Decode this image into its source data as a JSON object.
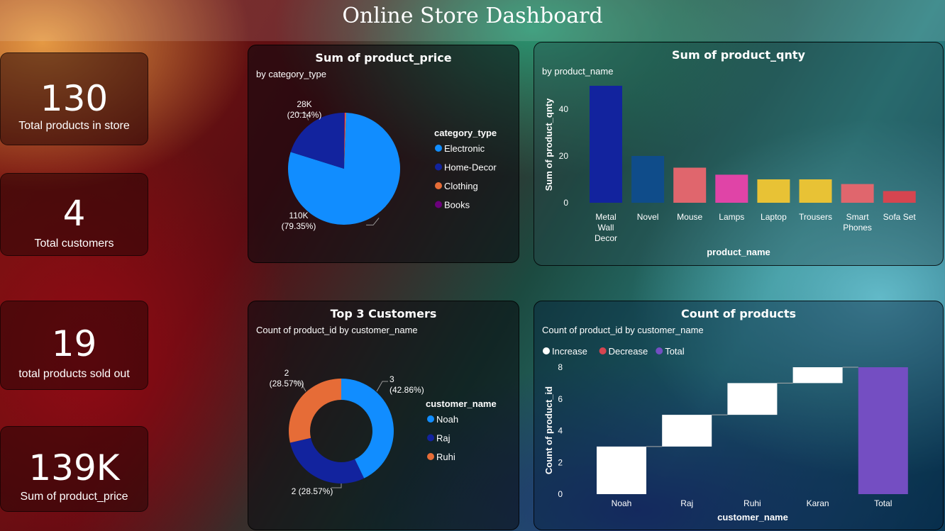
{
  "page_title": "Online Store Dashboard",
  "kpis": [
    {
      "value": "130",
      "label": "Total products in store"
    },
    {
      "value": "4",
      "label": "Total customers"
    },
    {
      "value": "19",
      "label": "total products sold out"
    },
    {
      "value": "139K",
      "label": "Sum of product_price"
    }
  ],
  "pie_card": {
    "title": "Sum of product_price",
    "subtitle": "by category_type"
  },
  "bar_card": {
    "title": "Sum of product_qnty",
    "subtitle": "by product_name"
  },
  "donut_card": {
    "title": "Top 3 Customers",
    "subtitle": "Count of product_id by customer_name"
  },
  "waterfall_card": {
    "title": "Count of products",
    "subtitle": "Count of product_id by customer_name"
  },
  "chart_data": [
    {
      "type": "pie",
      "title": "Sum of product_price",
      "subtitle": "by category_type",
      "legend_title": "category_type",
      "legend_position": "right",
      "categories": [
        "Electronic",
        "Home-Decor",
        "Clothing",
        "Books"
      ],
      "values": [
        110,
        28,
        0.5,
        0.3
      ],
      "data_labels": [
        "110K\n(79.35%)",
        "28K\n(20.14%)",
        "",
        ""
      ],
      "colors": [
        "#118DFF",
        "#12239E",
        "#E66C37",
        "#6B007B"
      ]
    },
    {
      "type": "bar",
      "title": "Sum of product_qnty",
      "subtitle": "by product_name",
      "xlabel": "product_name",
      "ylabel": "Sum of product_qnty",
      "ylim": [
        0,
        50
      ],
      "yticks": [
        0,
        20,
        40
      ],
      "categories": [
        "Metal Wall Decor",
        "Novel",
        "Mouse",
        "Lamps",
        "Laptop",
        "Trousers",
        "Smart Phones",
        "Sofa Set"
      ],
      "values": [
        50,
        20,
        15,
        12,
        10,
        10,
        8,
        5
      ],
      "colors": [
        "#12239E",
        "#0F4C8A",
        "#E0666D",
        "#E044A7",
        "#E8C235",
        "#E8C235",
        "#E0666D",
        "#D64550"
      ],
      "grid": false
    },
    {
      "type": "pie",
      "subtype": "donut",
      "title": "Top 3 Customers",
      "subtitle": "Count of product_id by customer_name",
      "legend_title": "customer_name",
      "legend_position": "right",
      "categories": [
        "Noah",
        "Raj",
        "Ruhi"
      ],
      "values": [
        3,
        2,
        2
      ],
      "data_labels": [
        "3\n(42.86%)",
        "2 (28.57%)",
        "2\n(28.57%)"
      ],
      "colors": [
        "#118DFF",
        "#12239E",
        "#E66C37"
      ]
    },
    {
      "type": "bar",
      "subtype": "waterfall",
      "title": "Count of products",
      "subtitle": "Count of product_id by customer_name",
      "xlabel": "customer_name",
      "ylabel": "Count of product_id",
      "ylim": [
        0,
        8
      ],
      "yticks": [
        0,
        2,
        4,
        6,
        8
      ],
      "legend": [
        "Increase",
        "Decrease",
        "Total"
      ],
      "legend_colors": [
        "#FFFFFF",
        "#D64550",
        "#744EC2"
      ],
      "legend_position": "top-left",
      "categories": [
        "Noah",
        "Raj",
        "Ruhi",
        "Karan",
        "Total"
      ],
      "values": [
        3,
        2,
        2,
        1,
        8
      ],
      "grid": false
    }
  ]
}
